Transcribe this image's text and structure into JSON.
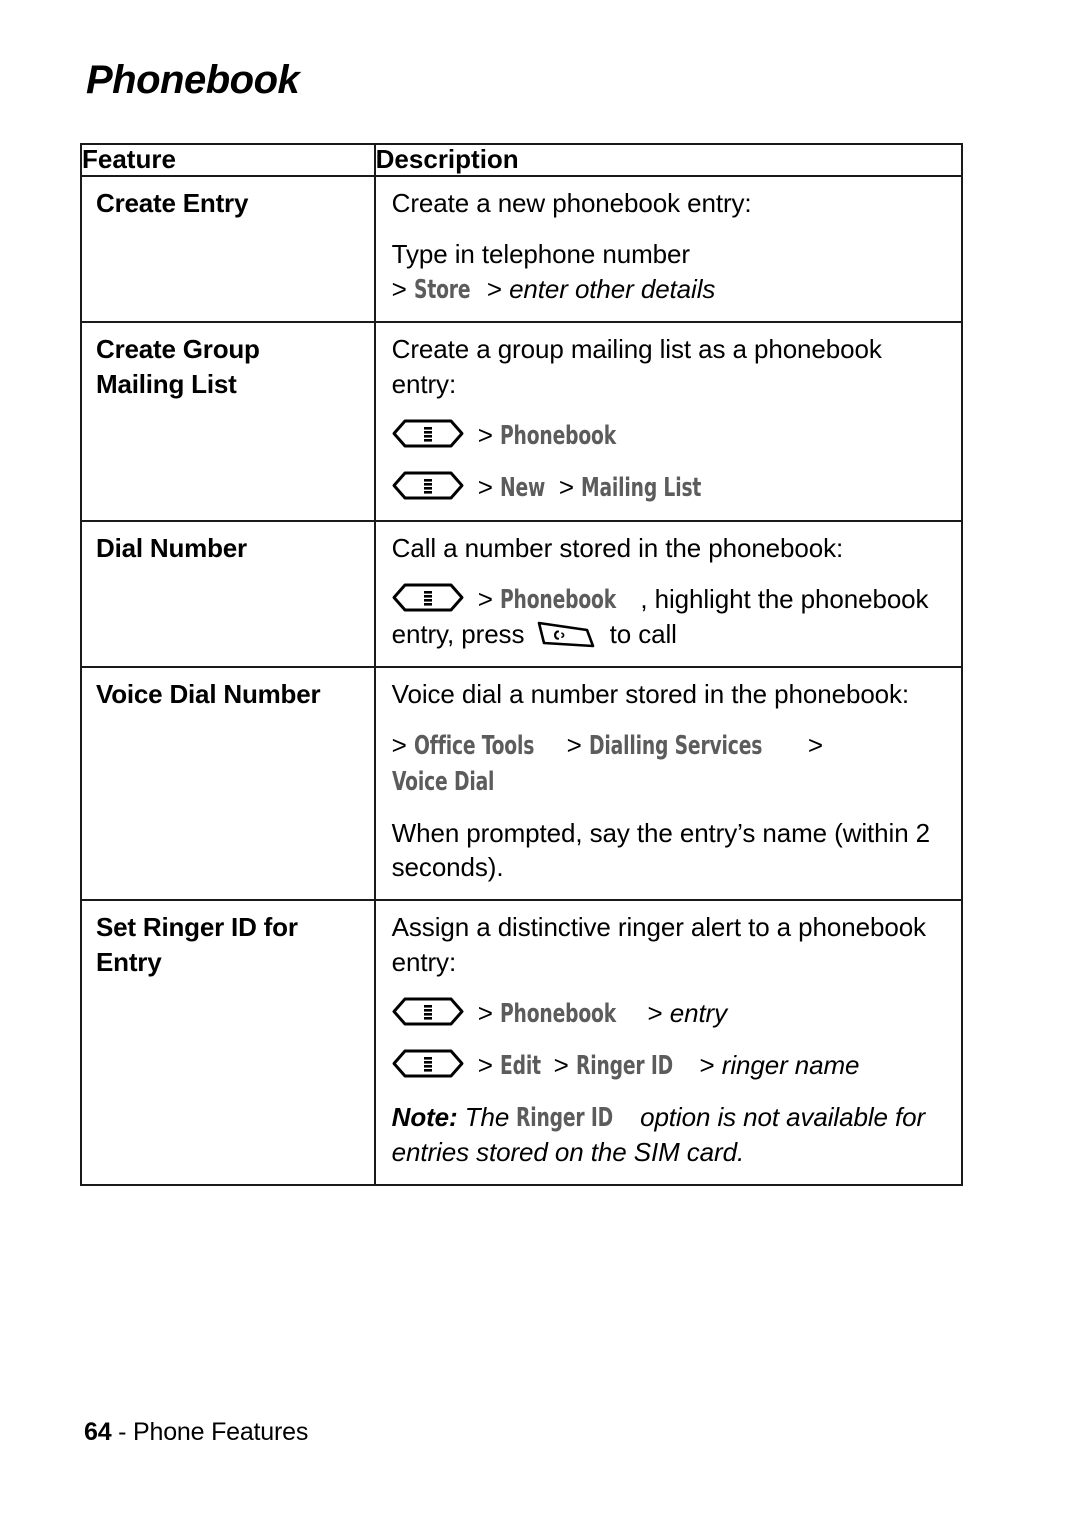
{
  "page": {
    "title": "Phonebook",
    "footer": {
      "page_number": "64",
      "separator": " - ",
      "section": "Phone Features"
    }
  },
  "table": {
    "headers": {
      "feature": "Feature",
      "description": "Description"
    },
    "rows": [
      {
        "feature": "Create Entry",
        "lines": [
          {
            "kind": "text",
            "text": "Create a new phonebook entry:"
          },
          {
            "kind": "text",
            "text": "Type in telephone number"
          },
          {
            "kind": "path",
            "segments": [
              {
                "type": "chevron",
                "text": ">"
              },
              {
                "type": "softkey",
                "text": "Store"
              },
              {
                "type": "chevron",
                "text": ">"
              },
              {
                "type": "italic",
                "text": "enter other details"
              }
            ]
          }
        ]
      },
      {
        "feature": "Create Group Mailing List",
        "feature_line1": "Create Group",
        "feature_line2": "Mailing List",
        "lines": [
          {
            "kind": "text",
            "text": "Create a group mailing list as a phonebook entry:"
          },
          {
            "kind": "path",
            "icon": "menu-key-icon",
            "segments": [
              {
                "type": "chevron",
                "text": ">"
              },
              {
                "type": "softkey",
                "text": "Phonebook"
              }
            ]
          },
          {
            "kind": "path",
            "icon": "menu-key-icon",
            "segments": [
              {
                "type": "chevron",
                "text": ">"
              },
              {
                "type": "softkey",
                "text": "New"
              },
              {
                "type": "chevron",
                "text": ">"
              },
              {
                "type": "softkey",
                "text": "Mailing List"
              }
            ]
          }
        ]
      },
      {
        "feature": "Dial Number",
        "lines": [
          {
            "kind": "text",
            "text": "Call a number stored in the phonebook:"
          },
          {
            "kind": "path",
            "icon": "menu-key-icon",
            "segments": [
              {
                "type": "chevron",
                "text": ">"
              },
              {
                "type": "softkey",
                "text": "Phonebook"
              },
              {
                "type": "text",
                "text": ", highlight the phonebook entry, press "
              },
              {
                "type": "icon",
                "text": "send-key-icon"
              },
              {
                "type": "text",
                "text": " to call"
              }
            ]
          }
        ]
      },
      {
        "feature": "Voice Dial Number",
        "lines": [
          {
            "kind": "text",
            "text": "Voice dial a number stored in the phonebook:"
          },
          {
            "kind": "path",
            "segments": [
              {
                "type": "chevron",
                "text": ">"
              },
              {
                "type": "softkey",
                "text": "Office Tools"
              },
              {
                "type": "chevron",
                "text": ">"
              },
              {
                "type": "softkey",
                "text": "Dialling Services"
              },
              {
                "type": "chevron",
                "text": ">"
              },
              {
                "type": "softkey",
                "text": "Voice Dial"
              }
            ]
          },
          {
            "kind": "text",
            "text": "When prompted, say the entry’s name (within 2 seconds)."
          }
        ]
      },
      {
        "feature": "Set Ringer ID for Entry",
        "feature_line1": "Set Ringer ID for",
        "feature_line2": "Entry",
        "lines": [
          {
            "kind": "text",
            "text": "Assign a distinctive ringer alert to a phonebook entry:"
          },
          {
            "kind": "path",
            "icon": "menu-key-icon",
            "segments": [
              {
                "type": "chevron",
                "text": ">"
              },
              {
                "type": "softkey",
                "text": "Phonebook"
              },
              {
                "type": "chevron",
                "text": ">"
              },
              {
                "type": "italic",
                "text": "entry"
              }
            ]
          },
          {
            "kind": "path",
            "icon": "menu-key-icon",
            "segments": [
              {
                "type": "chevron",
                "text": ">"
              },
              {
                "type": "softkey",
                "text": "Edit"
              },
              {
                "type": "chevron",
                "text": ">"
              },
              {
                "type": "softkey",
                "text": "Ringer ID"
              },
              {
                "type": "chevron",
                "text": ">"
              },
              {
                "type": "italic",
                "text": "ringer name"
              }
            ]
          },
          {
            "kind": "note",
            "segments": [
              {
                "type": "bolditalic",
                "text": "Note:"
              },
              {
                "type": "italic",
                "text": " The "
              },
              {
                "type": "softkey",
                "text": "Ringer ID"
              },
              {
                "type": "italic",
                "text": " option is not available for entries stored on the SIM card."
              }
            ]
          }
        ]
      }
    ]
  },
  "colors": {
    "softkey_grey": "#5c5c5c",
    "border": "#1a1a1a",
    "text": "#000000",
    "background": "#ffffff"
  }
}
